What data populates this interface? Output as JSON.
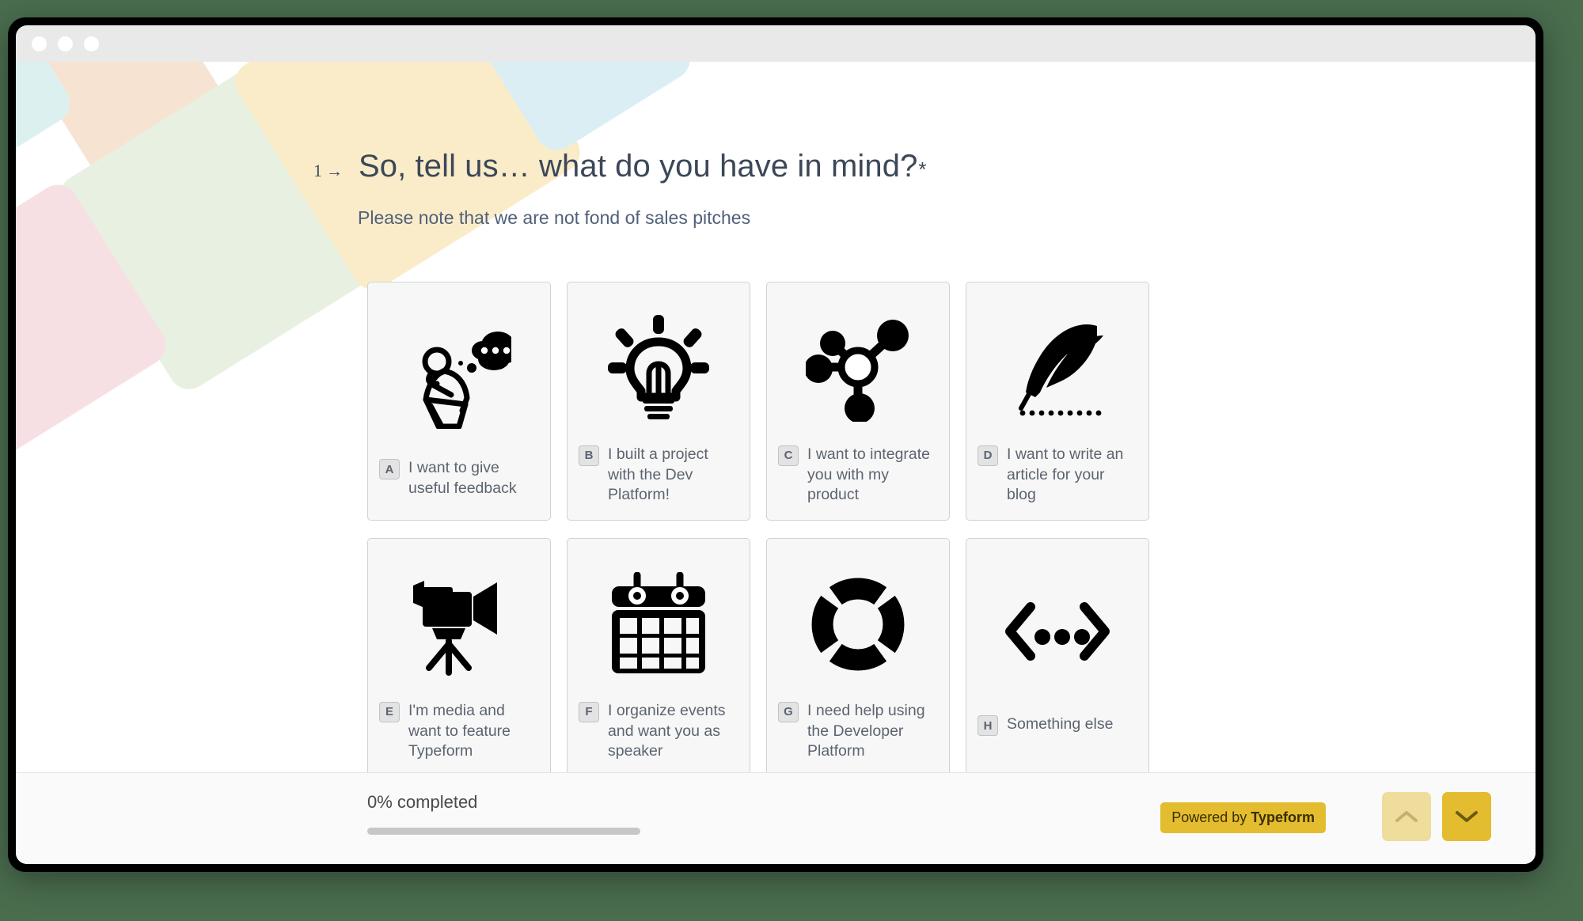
{
  "window": {
    "traffic_lights": [
      "close-dot",
      "minimize-dot",
      "maximize-dot"
    ]
  },
  "background": {
    "page_color": "#4a6d4e",
    "decor_shapes": [
      {
        "name": "peach-square",
        "color": "#f7e3d2"
      },
      {
        "name": "mint-square",
        "color": "#e8f0e1"
      },
      {
        "name": "cream-square",
        "color": "#faecc9"
      },
      {
        "name": "lightblue-square",
        "color": "#dcf0f0"
      },
      {
        "name": "pink-square",
        "color": "#f6e0e4"
      },
      {
        "name": "blue-square",
        "color": "#dbeef4"
      }
    ]
  },
  "question": {
    "number": "1",
    "arrow": "→",
    "title": "So, tell us… what do you have in mind?",
    "required_marker": "*",
    "subtitle": "Please note that we are not fond of sales pitches"
  },
  "choices": [
    {
      "key": "A",
      "label": "I want to give useful feedback",
      "icon": "thinker-icon"
    },
    {
      "key": "B",
      "label": "I built a project with the Dev Platform!",
      "icon": "lightbulb-icon"
    },
    {
      "key": "C",
      "label": "I want to integrate you with my product",
      "icon": "molecule-icon"
    },
    {
      "key": "D",
      "label": "I want to write an article for your blog",
      "icon": "quill-pen-icon"
    },
    {
      "key": "E",
      "label": "I'm media and want to feature Typeform",
      "icon": "video-camera-icon"
    },
    {
      "key": "F",
      "label": "I organize events and want you as speaker",
      "icon": "calendar-icon"
    },
    {
      "key": "G",
      "label": "I need help using the Developer Platform",
      "icon": "lifebuoy-icon"
    },
    {
      "key": "H",
      "label": "Something else",
      "icon": "code-brackets-icon"
    }
  ],
  "footer": {
    "progress_label": "0% completed",
    "progress_percent": 0,
    "brand_prefix": "Powered by ",
    "brand_name": "Typeform",
    "brand_color": "#e4bc2f",
    "nav_up": "previous-question",
    "nav_down": "next-question"
  }
}
